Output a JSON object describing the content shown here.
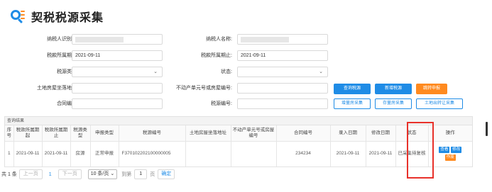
{
  "title": "契税税源采集",
  "colors": {
    "primary": "#1f8ce6",
    "orange": "#ff8a1f",
    "highlight": "#e8312a"
  },
  "form": {
    "taxpayer_id_label": "纳税人识别号:",
    "taxpayer_name_label": "纳税人名称:",
    "period_start_label": "税款所属期起:",
    "period_start_value": "2021-09-11",
    "period_end_label": "税款所属期止:",
    "period_end_value": "2021-09-11",
    "source_type_label": "税源类型:",
    "status_label": "状态:",
    "location_label": "土地房屋坐落地址:",
    "unit_no_label": "不动产单元号或房屋编号:",
    "contract_no_label": "合同编号:",
    "source_no_label": "税源编号:"
  },
  "buttons": {
    "query": "查询税源",
    "add": "新增税源",
    "transfer": "跳转申报",
    "incr_house": "增量房采集",
    "stock_house": "存量房采集",
    "land_transfer": "土地出转让采集"
  },
  "results": {
    "header": "查询结果",
    "columns": [
      "序号",
      "税款所属期起",
      "税款所属期止",
      "税源类型",
      "申报类型",
      "税源编号",
      "土地房屋坐落地址",
      "不动产单元号或房屋编号",
      "合同编号",
      "录入日期",
      "修改日期",
      "状态",
      "操作"
    ],
    "rows": [
      {
        "index": "1",
        "start": "2021-09-11",
        "end": "2021-09-11",
        "source_type": "房源",
        "declare_type": "正常申报",
        "source_no": "F370102202100000005",
        "location": "",
        "unit_no": "",
        "contract_no": "234234",
        "entry_date": "2021-09-11",
        "modify_date": "2021-09-11",
        "status": "已采集待复核",
        "ops": {
          "view": "查看",
          "edit": "修改",
          "void": "作废"
        }
      }
    ]
  },
  "pager": {
    "total": "共 1 条",
    "prev": "上一页",
    "current": "1",
    "next": "下一页",
    "page_size": "10 条/页",
    "goto": "到第",
    "goto_page": "1",
    "page_unit": "页",
    "confirm": "确定"
  }
}
